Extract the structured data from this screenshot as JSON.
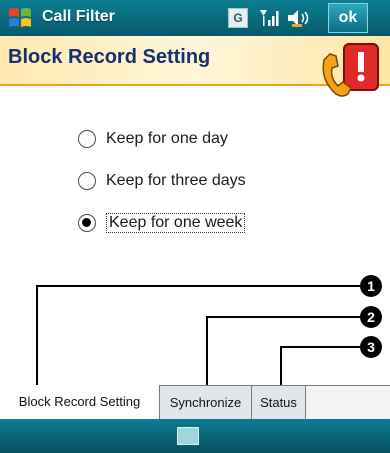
{
  "titlebar": {
    "title": "Call Filter",
    "tray_letter": "G",
    "ok_label": "ok"
  },
  "header": {
    "title": "Block Record Setting"
  },
  "options": [
    {
      "label": "Keep for one day",
      "selected": false
    },
    {
      "label": "Keep for three days",
      "selected": false
    },
    {
      "label": "Keep for one week",
      "selected": true
    }
  ],
  "tabs": [
    {
      "label": "Block Record Setting",
      "active": true
    },
    {
      "label": "Synchronize",
      "active": false
    },
    {
      "label": "Status",
      "active": false
    }
  ],
  "callouts": [
    "1",
    "2",
    "3"
  ],
  "colors": {
    "titlebar": "#0c7f93",
    "header_title": "#15306e",
    "header_accent": "#f2a41c"
  }
}
